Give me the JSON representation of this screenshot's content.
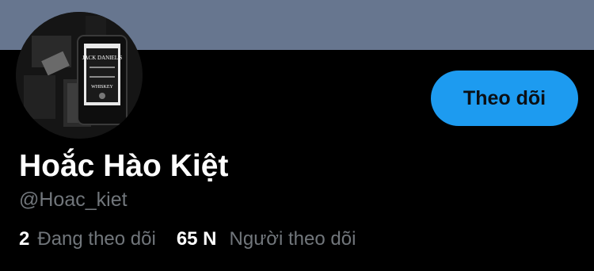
{
  "profile": {
    "display_name": "Hoắc Hào Kiệt",
    "handle": "@Hoac_kiet",
    "avatar_label": "JACK DANIEL'S TENNESSEE WHISKEY",
    "avatar_brand": "JACK DANIEL'S",
    "avatar_sub": "WHISKEY"
  },
  "actions": {
    "follow_label": "Theo dõi"
  },
  "stats": {
    "following_count": "2",
    "following_label": "Đang theo dõi",
    "followers_count": "65 N",
    "followers_label": "Người theo dõi"
  },
  "colors": {
    "banner": "#67768f",
    "accent": "#1d9bf0",
    "background": "#000000",
    "muted_text": "#71767b"
  }
}
